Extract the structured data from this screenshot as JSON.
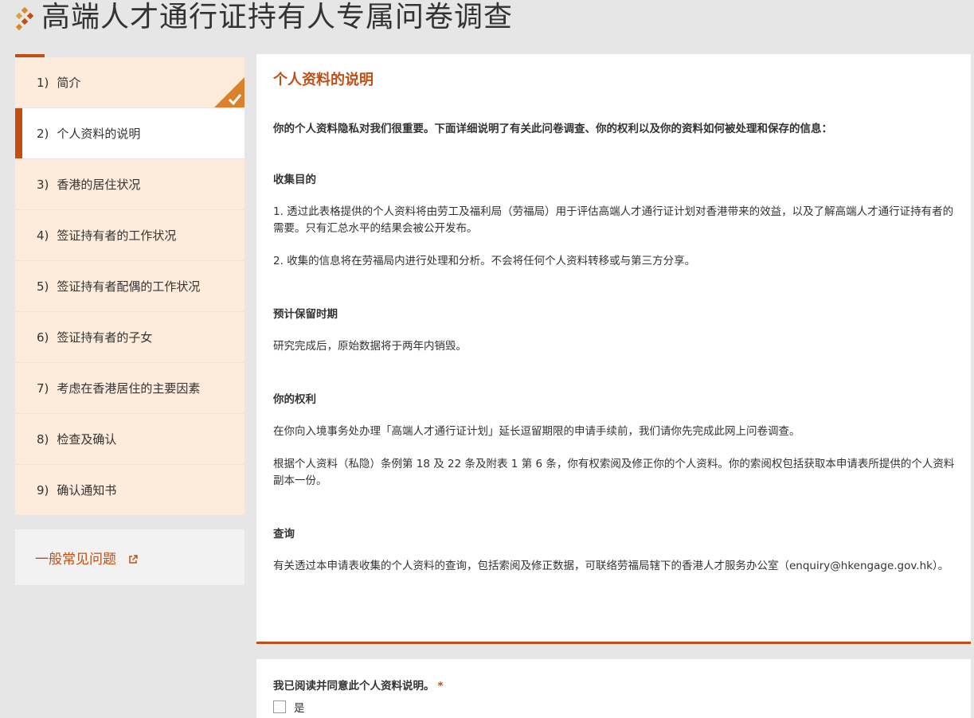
{
  "header": {
    "title": "高端人才通行证持有人专属问卷调查",
    "logo_icon": "diamond-logo-icon"
  },
  "colors": {
    "accent": "#c04f15",
    "step_bg": "#fdebdb",
    "page_bg": "#e6e6e6"
  },
  "sidebar": {
    "steps": [
      {
        "num": "1)",
        "label": "简介",
        "status": "completed"
      },
      {
        "num": "2)",
        "label": "个人资料的说明",
        "status": "active"
      },
      {
        "num": "3)",
        "label": "香港的居住状况",
        "status": "pending"
      },
      {
        "num": "4)",
        "label": "签证持有者的工作状况",
        "status": "pending"
      },
      {
        "num": "5)",
        "label": "签证持有者配偶的工作状况",
        "status": "pending"
      },
      {
        "num": "6)",
        "label": "签证持有者的子女",
        "status": "pending"
      },
      {
        "num": "7)",
        "label": "考虑在香港居住的主要因素",
        "status": "pending"
      },
      {
        "num": "8)",
        "label": "检查及确认",
        "status": "pending"
      },
      {
        "num": "9)",
        "label": "确认通知书",
        "status": "pending"
      }
    ],
    "faq_label": "一般常见问题",
    "faq_icon": "external-link-icon"
  },
  "main": {
    "title": "个人资料的说明",
    "intro": "你的个人资料隐私对我们很重要。下面详细说明了有关此问卷调查、你的权利以及你的资料如何被处理和保存的信息：",
    "purpose_heading": "收集目的",
    "purpose_p1": "1. 透过此表格提供的个人资料将由劳工及福利局（劳福局）用于评估高端人才通行证计划对香港带来的效益，以及了解高端人才通行证持有者的需要。只有汇总水平的结果会被公开发布。",
    "purpose_p2": "2. 收集的信息将在劳福局内进行处理和分析。不会将任何个人资料转移或与第三方分享。",
    "retention_heading": "预计保留时期",
    "retention_p": "研究完成后，原始数据将于两年内销毁。",
    "rights_heading": "你的权利",
    "rights_p1": "在你向入境事务处办理「高端人才通行证计划」延长逗留期限的申请手续前，我们请你先完成此网上问卷调查。",
    "rights_p2": "根据个人资料（私隐）条例第 18 及 22 条及附表 1 第 6 条，你有权索阅及修正你的个人资料。你的索阅权包括获取本申请表所提供的个人资料副本一份。",
    "enquiry_heading": "查询",
    "enquiry_p": "有关透过本申请表收集的个人资料的查询，包括索阅及修正数据，可联络劳福局辖下的香港人才服务办公室（enquiry@hkengage.gov.hk）。"
  },
  "agreement": {
    "question": "我已阅读并同意此个人资料说明。",
    "required_mark": "*",
    "option_label": "是",
    "checked": false
  }
}
